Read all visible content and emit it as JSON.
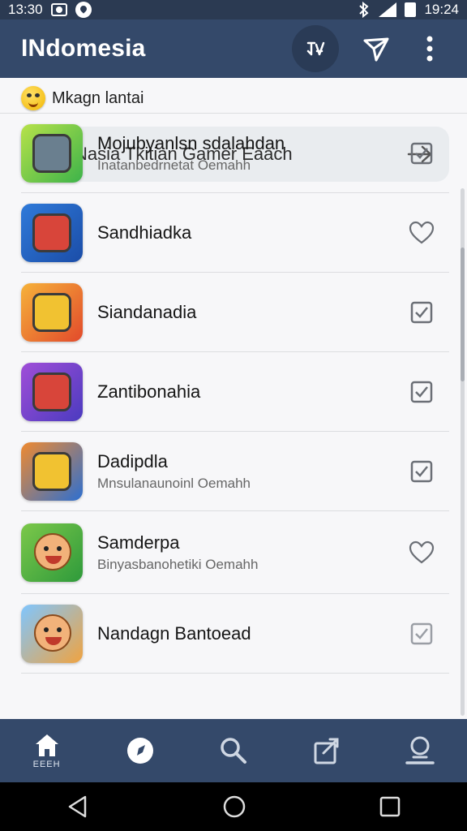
{
  "status_bar": {
    "time_left": "13:30",
    "time_right": "19:24"
  },
  "app_bar": {
    "title": "INdomesia"
  },
  "banner": {
    "text": "Mkagn lantai"
  },
  "search": {
    "text": "Nasia Tkitian Gamer Eaach"
  },
  "list": [
    {
      "title": "Mojubyanlsn sdalahdan",
      "subtitle": "Inatanbedrnetat Oemahh",
      "action": "checkbox",
      "icon": "robot-game-icon"
    },
    {
      "title": "Sandhiadka",
      "subtitle": "",
      "action": "heart",
      "icon": "robot-game-icon"
    },
    {
      "title": "Siandanadia",
      "subtitle": "",
      "action": "checkbox",
      "icon": "robot-game-icon"
    },
    {
      "title": "Zantibonahia",
      "subtitle": "",
      "action": "checkbox",
      "icon": "robot-game-icon"
    },
    {
      "title": "Dadipdla",
      "subtitle": "Mnsulanaunoinl Oemahh",
      "action": "checkbox",
      "icon": "cannon-game-icon"
    },
    {
      "title": "Samderpa",
      "subtitle": "Binyasbanohetiki Oemahh",
      "action": "heart",
      "icon": "monkey-game-icon"
    },
    {
      "title": "Nandagn Bantoead",
      "subtitle": "",
      "action": "checkbox",
      "icon": "monkey-game-icon"
    }
  ],
  "bottom_nav": {
    "home_label": "EEEH"
  },
  "colors": {
    "app_bar": "#34496a",
    "status_bar": "#2b3a52",
    "background": "#f7f7f9"
  }
}
